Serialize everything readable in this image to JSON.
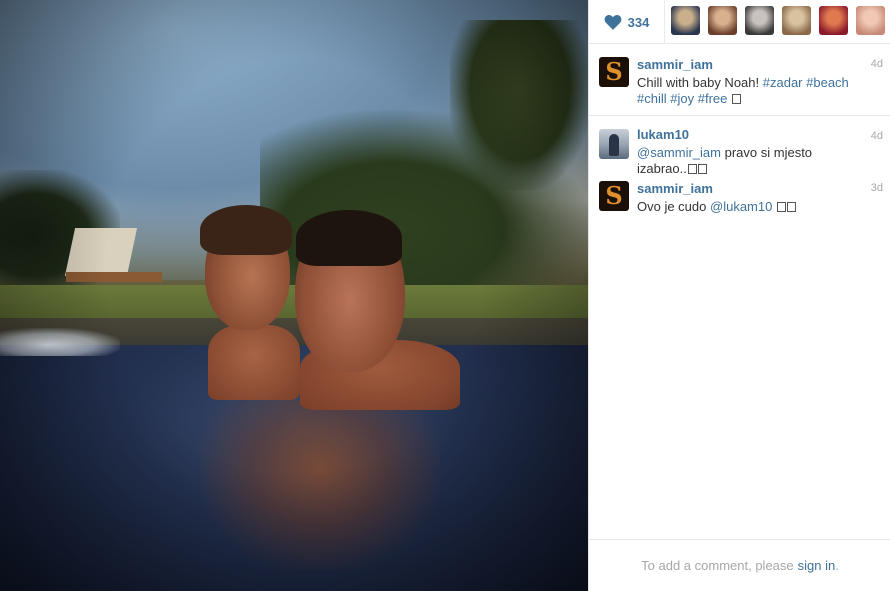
{
  "likes": {
    "count": "334",
    "icon": "heart-icon",
    "color": "#3f729b"
  },
  "likers": [
    {
      "name": "liker-avatar-1",
      "colors": [
        "#2a3550",
        "#c9b08a"
      ]
    },
    {
      "name": "liker-avatar-2",
      "colors": [
        "#6a3f2c",
        "#d8b08e"
      ]
    },
    {
      "name": "liker-avatar-3",
      "colors": [
        "#3a3a3a",
        "#c9c3bf"
      ]
    },
    {
      "name": "liker-avatar-4",
      "colors": [
        "#8a6a48",
        "#d9c2a0"
      ]
    },
    {
      "name": "liker-avatar-5",
      "colors": [
        "#8a1a2a",
        "#e07850"
      ]
    },
    {
      "name": "liker-avatar-6",
      "colors": [
        "#c88a78",
        "#f0c8b4"
      ]
    }
  ],
  "caption": {
    "user": "sammir_iam",
    "time": "4d",
    "text_plain": "Chill with baby Noah!",
    "hashtags": [
      "#zadar",
      "#beach",
      "#chill",
      "#joy",
      "#free"
    ]
  },
  "comments": [
    {
      "user": "lukam10",
      "time": "4d",
      "mention": "@sammir_iam",
      "text": "pravo si mjesto izabrao.."
    },
    {
      "user": "sammir_iam",
      "time": "3d",
      "text": "Ovo je cudo",
      "mention": "@lukam10"
    }
  ],
  "footer": {
    "prompt": "To add a comment, please",
    "link": "sign in",
    "end": "."
  }
}
